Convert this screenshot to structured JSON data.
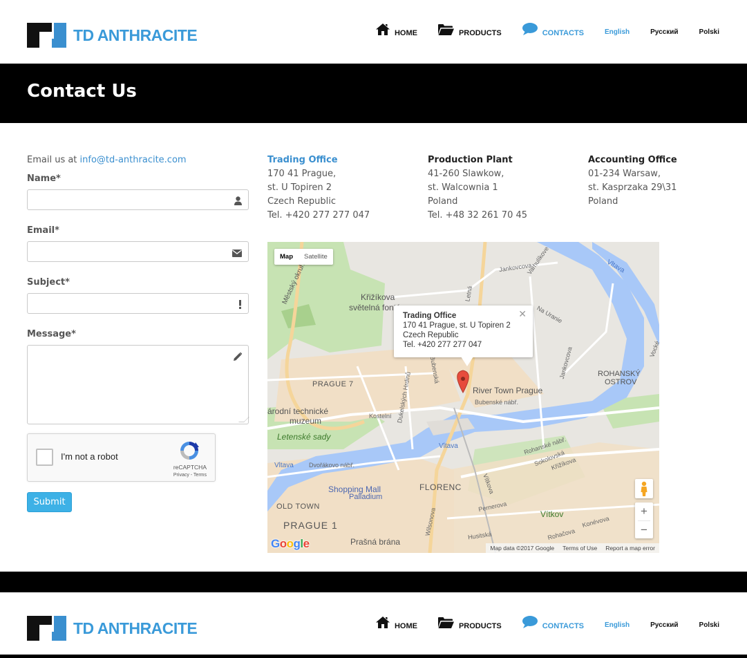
{
  "brand": {
    "name": "TD ANTHRACITE",
    "accent": "#3a9ad9"
  },
  "nav": {
    "items": [
      {
        "label": "HOME",
        "icon": "home-icon"
      },
      {
        "label": "PRODUCTS",
        "icon": "folder-open-icon"
      },
      {
        "label": "CONTACTS",
        "icon": "speech-bubble-icon"
      }
    ],
    "languages": [
      "English",
      "Русский",
      "Polski"
    ]
  },
  "banner": {
    "title": "Contact Us"
  },
  "form": {
    "email_prefix": "Email us at ",
    "email_address": "info@td-anthracite.com",
    "name_label": "Name*",
    "email_label": "Email*",
    "subject_label": "Subject*",
    "message_label": "Message*",
    "name_value": "",
    "email_value": "",
    "subject_value": "",
    "message_value": "",
    "recaptcha_label": "I'm not a robot",
    "recaptcha_brand": "reCAPTCHA",
    "recaptcha_links": "Privacy - Terms",
    "submit_label": "Submit"
  },
  "offices": [
    {
      "title": "Trading Office",
      "lines": [
        "170 41 Prague,",
        "st. U Topiren 2",
        "Czech Republic",
        "Tel. +420 277 277 047"
      ]
    },
    {
      "title": "Production Plant",
      "lines": [
        "41-260 Slawkow,",
        "st. Walcownia 1",
        "Poland",
        "Tel. +48 32 261 70 45"
      ]
    },
    {
      "title": "Accounting Office",
      "lines": [
        "01-234 Warsaw,",
        "st. Kasprzaka 29\\31",
        "Poland"
      ]
    }
  ],
  "map": {
    "type_map": "Map",
    "type_satellite": "Satellite",
    "info_title": "Trading Office",
    "info_lines": [
      "170 41 Prague, st. U Topiren 2",
      "Czech Republic",
      "Tel. +420 277 277 047"
    ],
    "zoom_in": "+",
    "zoom_out": "−",
    "footer": [
      "Map data ©2017 Google",
      "Terms of Use",
      "Report a map error"
    ],
    "google": "Google",
    "labels": [
      {
        "text": "Křižíkova",
        "cls": "l1"
      },
      {
        "text": "světelná fontána",
        "cls": "l2"
      },
      {
        "text": "PRAGUE 7",
        "cls": "l3"
      },
      {
        "text": "River Town Prague",
        "cls": "l4"
      },
      {
        "text": "ROHANSKÝ",
        "cls": "l5"
      },
      {
        "text": "OSTROV",
        "cls": "l6"
      },
      {
        "text": "árodní technické",
        "cls": "l7"
      },
      {
        "text": "muzeum",
        "cls": "l8"
      },
      {
        "text": "Letenské sady",
        "cls": "l9"
      },
      {
        "text": "Shopping Mall",
        "cls": "l10"
      },
      {
        "text": "Palladium",
        "cls": "l11"
      },
      {
        "text": "FLORENC",
        "cls": "l12"
      },
      {
        "text": "OLD TOWN",
        "cls": "l13"
      },
      {
        "text": "PRAGUE 1",
        "cls": "l14"
      },
      {
        "text": "Prašná brána",
        "cls": "l15"
      },
      {
        "text": "Vítkov",
        "cls": "l16"
      },
      {
        "text": "Vltava",
        "cls": "l17"
      },
      {
        "text": "Kostelní",
        "cls": "l18"
      },
      {
        "text": "Dvořákovo nábř.",
        "cls": "l19"
      },
      {
        "text": "Bubenské nábř.",
        "cls": "l20"
      },
      {
        "text": "Rohanské nábř.",
        "cls": "l21"
      },
      {
        "text": "Sokolovská",
        "cls": "l22"
      },
      {
        "text": "Křižíkova",
        "cls": "l23"
      },
      {
        "text": "Pernerova",
        "cls": "l24"
      },
      {
        "text": "Jankovcova",
        "cls": "l25"
      },
      {
        "text": "Městský okruh",
        "cls": "l26"
      },
      {
        "text": "Wilsonova",
        "cls": "l27"
      },
      {
        "text": "Vltava",
        "cls": "l28"
      },
      {
        "text": "Dukelských Hrdinů",
        "cls": "l29"
      },
      {
        "text": "Bubenská",
        "cls": "l30"
      },
      {
        "text": "Jankovcova",
        "cls": "l31"
      },
      {
        "text": "Vltava",
        "cls": "l32"
      },
      {
        "text": "Konévova",
        "cls": "l33"
      },
      {
        "text": "Husitská",
        "cls": "l34"
      },
      {
        "text": "Rohačova",
        "cls": "l35"
      },
      {
        "text": "Vítkova",
        "cls": "l36"
      },
      {
        "text": "Varhulíkove",
        "cls": "l37"
      },
      {
        "text": "Na Uranie",
        "cls": "l38"
      },
      {
        "text": "Vocké",
        "cls": "l39"
      },
      {
        "text": "Letná",
        "cls": "l40"
      }
    ]
  }
}
